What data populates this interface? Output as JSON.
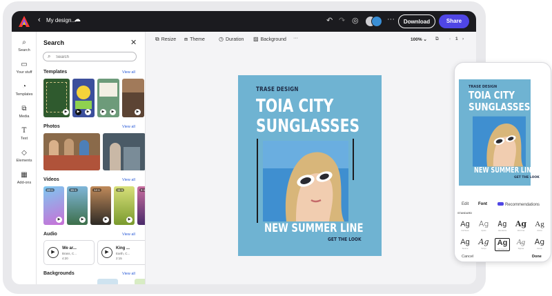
{
  "topbar": {
    "doc_name": "My design...",
    "download_label": "Download",
    "share_label": "Share"
  },
  "rail": {
    "items": [
      {
        "label": "Search",
        "icon": "search-icon"
      },
      {
        "label": "Your stuff",
        "icon": "folder-icon"
      },
      {
        "label": "Templates",
        "icon": "templates-icon"
      },
      {
        "label": "Media",
        "icon": "media-icon"
      },
      {
        "label": "Text",
        "icon": "text-icon"
      },
      {
        "label": "Elements",
        "icon": "elements-icon"
      },
      {
        "label": "Add-ons",
        "icon": "addons-icon"
      }
    ]
  },
  "panel": {
    "title": "Search",
    "search_placeholder": "Search",
    "view_all": "View all",
    "sections": {
      "templates": "Templates",
      "photos": "Photos",
      "videos": "Videos",
      "audio": "Audio",
      "backgrounds": "Backgrounds"
    },
    "video_durations": [
      "20 s",
      "15 s",
      "14 s",
      "11 s",
      "9 s"
    ],
    "audio": [
      {
        "title": "We ar...",
        "meta": "Brass, C...",
        "duration": "4:20"
      },
      {
        "title": "King ...",
        "meta": "Earth, C...",
        "duration": "2:15"
      }
    ]
  },
  "toolbar": {
    "resize": "Resize",
    "theme": "Theme",
    "duration": "Duration",
    "background": "Background",
    "zoom": "100%",
    "page_number": "1"
  },
  "design": {
    "brand": "TRASE DESIGN",
    "title_line1": "TOIA CITY",
    "title_line2": "SUNGLASSES",
    "subtitle": "NEW SUMMER LINE",
    "tagline": "GET THE LOOK"
  },
  "phone": {
    "tabs": [
      "Edit",
      "Font",
      "Recommendations"
    ],
    "label": "STANDARD",
    "fonts": [
      {
        "glyph": "Ag",
        "name": "Cal Sans"
      },
      {
        "glyph": "Ag",
        "name": "Aptos"
      },
      {
        "glyph": "Ag",
        "name": "Handwrite"
      },
      {
        "glyph": "Ag",
        "name": "Abril Fat"
      },
      {
        "glyph": "Ag",
        "name": "Arima"
      },
      {
        "glyph": "Ag",
        "name": "Source"
      },
      {
        "glyph": "Ag",
        "name": "Script"
      },
      {
        "glyph": "Ag",
        "name": "Montserrat"
      },
      {
        "glyph": "Ag",
        "name": "Sigmar"
      },
      {
        "glyph": "Ag",
        "name": "Avenir"
      }
    ],
    "cancel": "Cancel",
    "done": "Done"
  },
  "colors": {
    "accent": "#4f46e5",
    "poster_bg": "#6fb3d2",
    "topbar_bg": "#1b1b1f"
  }
}
